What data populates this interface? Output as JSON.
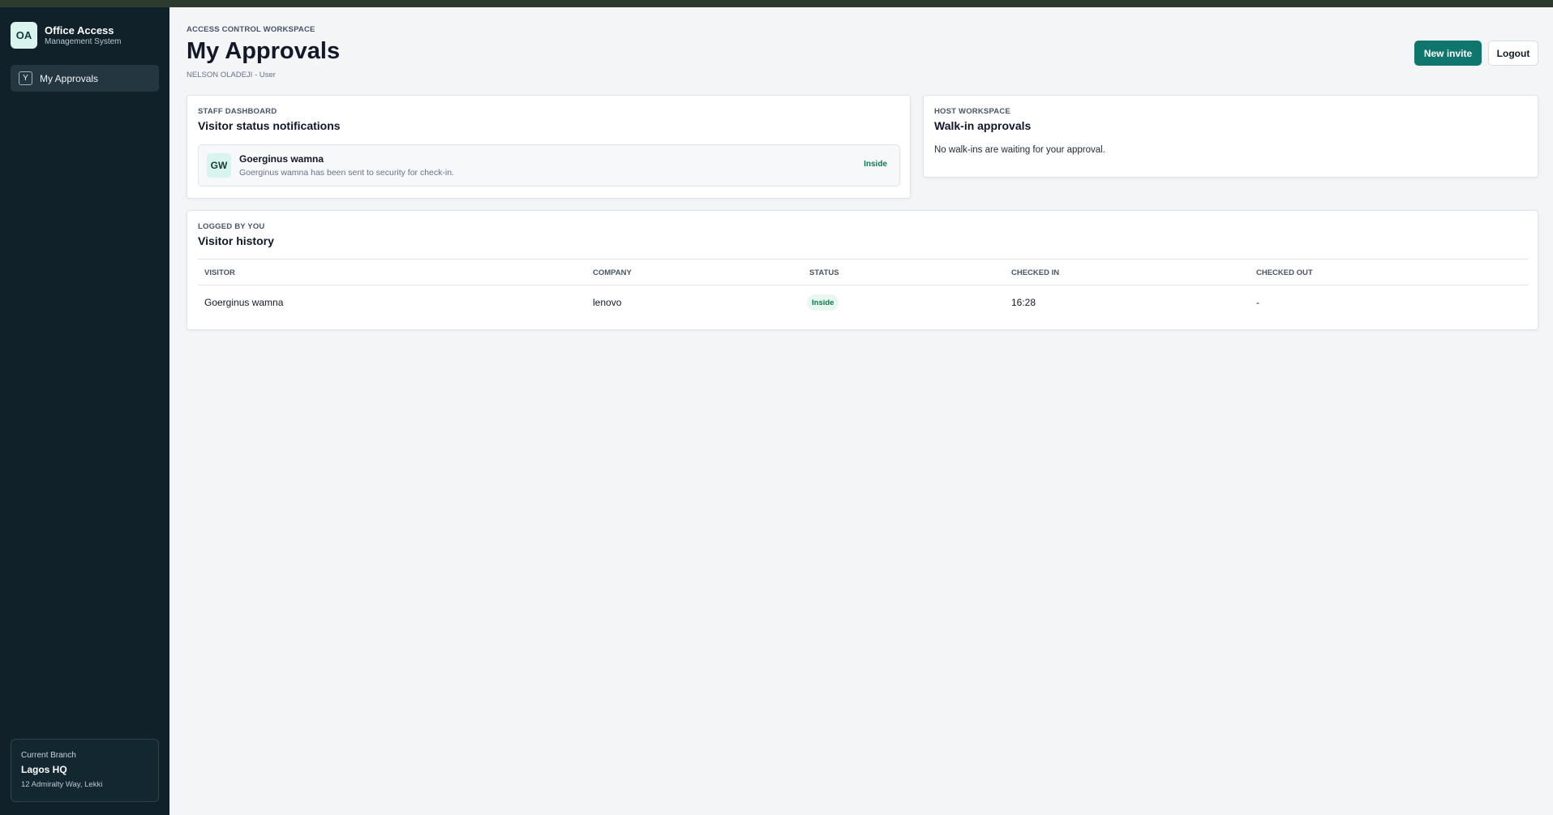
{
  "brand": {
    "initials": "OA",
    "name": "Office Access",
    "subtitle": "Management System"
  },
  "sidebar": {
    "items": [
      {
        "key": "Y",
        "label": "My Approvals"
      }
    ],
    "branch": {
      "caption": "Current Branch",
      "name": "Lagos HQ",
      "address": "12 Admiralty Way, Lekki"
    }
  },
  "header": {
    "eyebrow": "ACCESS CONTROL WORKSPACE",
    "title": "My Approvals",
    "user": "NELSON OLADEJI - User",
    "new_invite_label": "New invite",
    "logout_label": "Logout"
  },
  "notifications": {
    "eyebrow": "STAFF DASHBOARD",
    "title": "Visitor status notifications",
    "items": [
      {
        "initials": "GW",
        "name": "Goerginus wamna",
        "message": "Goerginus wamna has been sent to security for check-in.",
        "status": "Inside"
      }
    ]
  },
  "walkins": {
    "eyebrow": "HOST WORKSPACE",
    "title": "Walk-in approvals",
    "empty_text": "No walk-ins are waiting for your approval."
  },
  "history": {
    "eyebrow": "LOGGED BY YOU",
    "title": "Visitor history",
    "columns": [
      "VISITOR",
      "COMPANY",
      "STATUS",
      "CHECKED IN",
      "CHECKED OUT"
    ],
    "rows": [
      {
        "visitor": "Goerginus wamna",
        "company": "lenovo",
        "status": "Inside",
        "checked_in": "16:28",
        "checked_out": "-"
      }
    ]
  },
  "colors": {
    "sidebar": "#10212a",
    "accent": "#0f766e",
    "success": "#0f7a4f",
    "background": "#f3f5f7"
  }
}
